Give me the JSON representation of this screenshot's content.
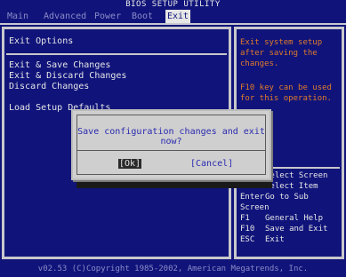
{
  "title": "BIOS SETUP UTILITY",
  "menu": [
    {
      "label": "Main"
    },
    {
      "label": "Advanced"
    },
    {
      "label": "Power"
    },
    {
      "label": "Boot"
    },
    {
      "label": "Exit"
    }
  ],
  "left_panel": {
    "section_title": "Exit Options",
    "options": [
      {
        "label": "Exit & Save Changes"
      },
      {
        "label": "Exit & Discard Changes"
      },
      {
        "label": "Discard Changes"
      },
      {
        "label": "Load Setup Defaults"
      }
    ]
  },
  "help": {
    "lines_top": [
      "Exit system setup",
      "after saving the",
      "changes."
    ],
    "lines_mid": [
      "F10 key can be used",
      "for this operation."
    ]
  },
  "keys": [
    {
      "key": "←→",
      "desc": "Select Screen"
    },
    {
      "key": "↑↓",
      "desc": "Select Item"
    },
    {
      "key": "Enter",
      "desc": "Go to Sub Screen"
    },
    {
      "key": "F1",
      "desc": "General Help"
    },
    {
      "key": "F10",
      "desc": "Save and Exit"
    },
    {
      "key": "ESC",
      "desc": "Exit"
    }
  ],
  "dialog": {
    "message": "Save configuration changes and exit now?",
    "ok": "[Ok]",
    "cancel": "[Cancel]"
  },
  "footer": "v02.53 (C)Copyright 1985-2002, American Megatrends, Inc.",
  "colors": {
    "background": "#10147a",
    "highlight_text": "#e07a2a",
    "panel_border": "#c8c8cc",
    "dialog_bg": "#cfcfcf"
  }
}
